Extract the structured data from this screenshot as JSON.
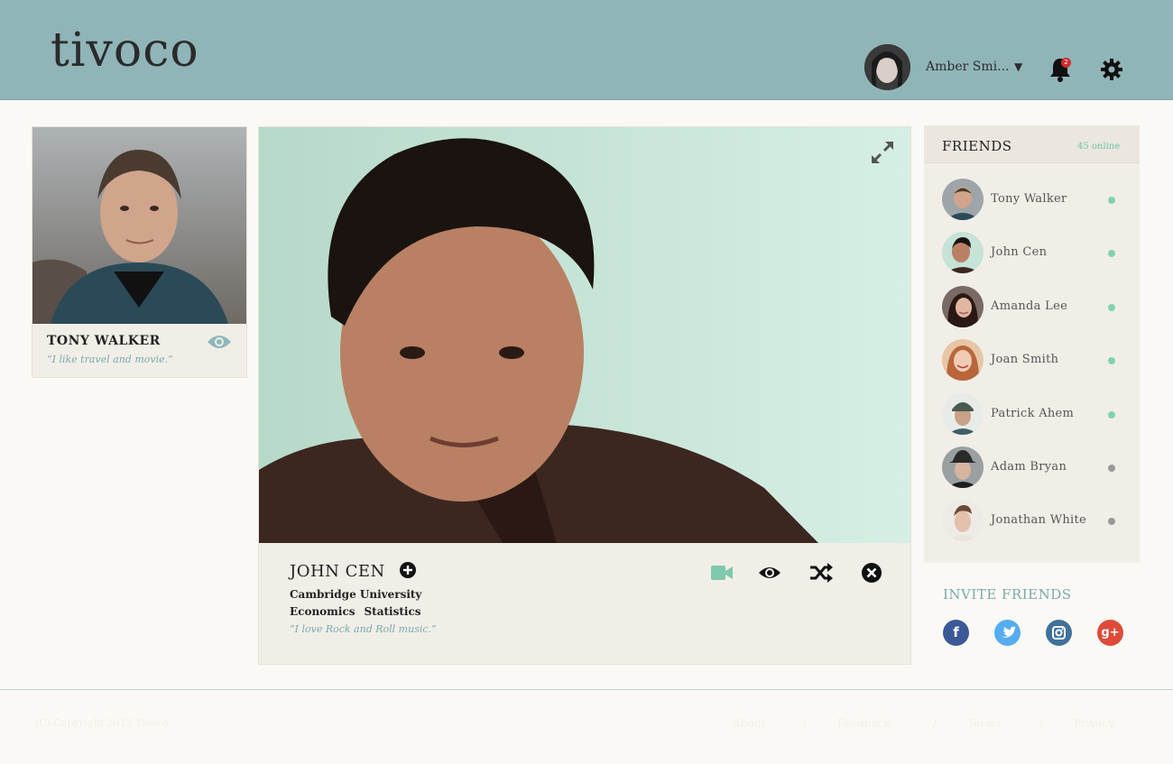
{
  "header": {
    "logo": "tivoco",
    "user_name": "Amber Smi...",
    "notification_count": "2"
  },
  "left_profile": {
    "name": "TONY WALKER",
    "quote": "“I like travel and movie.”"
  },
  "main_profile": {
    "name": "JOHN CEN",
    "university": "Cambridge University",
    "majors": [
      "Economics",
      "Statistics"
    ],
    "quote": "“I love Rock and Roll music.”"
  },
  "friends": {
    "title": "FRIENDS",
    "online_count": "45 online",
    "items": [
      {
        "name": "Tony Walker",
        "status": "online"
      },
      {
        "name": "John Cen",
        "status": "online"
      },
      {
        "name": "Amanda Lee",
        "status": "online"
      },
      {
        "name": "Joan Smith",
        "status": "online"
      },
      {
        "name": "Patrick Ahem",
        "status": "online"
      },
      {
        "name": "Adam Bryan",
        "status": "offline"
      },
      {
        "name": "Jonathan White",
        "status": "offline"
      }
    ]
  },
  "invite": {
    "title": "INVITE FRIENDS",
    "networks": [
      "facebook-icon",
      "twitter-icon",
      "instagram-icon",
      "google-plus-icon"
    ]
  },
  "footer": {
    "copyright": "(C) Copyright 2013 Tivoco",
    "links": [
      "About",
      "Feedback",
      "Terms",
      "Privacy"
    ]
  },
  "colors": {
    "header": "#90b5b8",
    "accent": "#7aa9ac",
    "online": "#7fd3b1",
    "offline": "#999999"
  }
}
